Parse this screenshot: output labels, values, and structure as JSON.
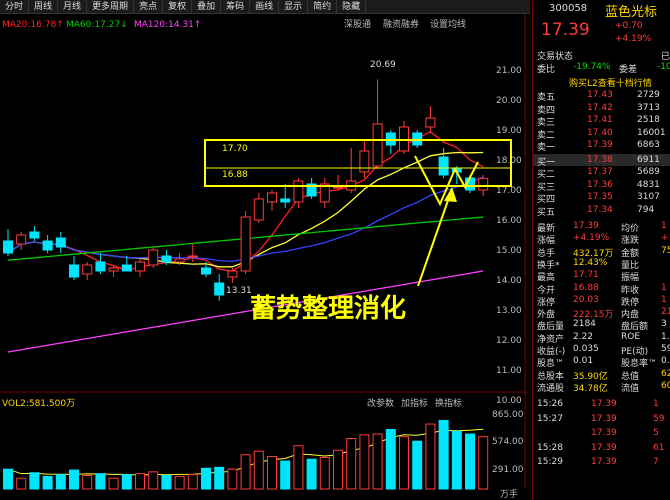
{
  "toolbar": [
    "分时",
    "周线",
    "月线",
    "更多周期",
    "亮点",
    "复权",
    "叠加",
    "筹码",
    "画线",
    "显示",
    "简约",
    "隐藏"
  ],
  "indicators": {
    "ma20": "MA20:16.78↑",
    "ma60": "MA60:17.27↓",
    "ma120": "MA120:14.31↑"
  },
  "chart_links": [
    "深股通",
    "融资融券",
    "设置均线"
  ],
  "y_ticks": [
    "21.00",
    "20.00",
    "19.00",
    "18.00",
    "17.00",
    "16.00",
    "15.00",
    "14.00",
    "13.00",
    "12.00",
    "11.00",
    "10.00"
  ],
  "annotations": {
    "high": "20.69",
    "low": "13.31",
    "box_upper": "17.70",
    "box_lower": "16.88",
    "caption": "蓄势整理消化"
  },
  "vol": {
    "label": "VOL2:581.500万",
    "ticks": [
      "865.00",
      "574.00",
      "291.00",
      "万手"
    ],
    "buttons": [
      "改参数",
      "加指标",
      "换指标"
    ]
  },
  "colors": {
    "up": "#ff3b3b",
    "down": "#00e5ff",
    "ma20": "#ff2020",
    "ma60": "#00cc00",
    "ma120": "#ff40ff",
    "short_ma": "#ffff33",
    "long_ma": "#3344ff",
    "accent": "#ffff00"
  },
  "candles": [
    {
      "o": 15.3,
      "h": 15.7,
      "l": 14.8,
      "c": 14.9
    },
    {
      "o": 15.2,
      "h": 15.6,
      "l": 15.0,
      "c": 15.5
    },
    {
      "o": 15.6,
      "h": 15.8,
      "l": 15.3,
      "c": 15.4
    },
    {
      "o": 15.3,
      "h": 15.5,
      "l": 14.9,
      "c": 15.0
    },
    {
      "o": 15.4,
      "h": 15.6,
      "l": 14.9,
      "c": 15.1
    },
    {
      "o": 14.5,
      "h": 14.8,
      "l": 14.0,
      "c": 14.1
    },
    {
      "o": 14.2,
      "h": 14.6,
      "l": 14.0,
      "c": 14.5
    },
    {
      "o": 14.6,
      "h": 14.9,
      "l": 14.2,
      "c": 14.3
    },
    {
      "o": 14.3,
      "h": 14.5,
      "l": 14.1,
      "c": 14.4
    },
    {
      "o": 14.5,
      "h": 14.8,
      "l": 14.3,
      "c": 14.3
    },
    {
      "o": 14.3,
      "h": 14.7,
      "l": 14.1,
      "c": 14.6
    },
    {
      "o": 14.5,
      "h": 15.1,
      "l": 14.4,
      "c": 15.0
    },
    {
      "o": 14.8,
      "h": 15.0,
      "l": 14.5,
      "c": 14.6
    },
    {
      "o": 14.6,
      "h": 14.9,
      "l": 14.5,
      "c": 14.7
    },
    {
      "o": 14.8,
      "h": 15.2,
      "l": 14.6,
      "c": 14.8
    },
    {
      "o": 14.4,
      "h": 14.6,
      "l": 14.1,
      "c": 14.2
    },
    {
      "o": 13.9,
      "h": 14.2,
      "l": 13.31,
      "c": 13.5
    },
    {
      "o": 14.1,
      "h": 14.4,
      "l": 13.9,
      "c": 14.3
    },
    {
      "o": 14.3,
      "h": 16.3,
      "l": 14.2,
      "c": 16.1
    },
    {
      "o": 16.0,
      "h": 16.9,
      "l": 15.9,
      "c": 16.7
    },
    {
      "o": 16.6,
      "h": 17.0,
      "l": 16.3,
      "c": 16.9
    },
    {
      "o": 16.7,
      "h": 17.2,
      "l": 16.4,
      "c": 16.6
    },
    {
      "o": 16.6,
      "h": 17.4,
      "l": 16.4,
      "c": 17.3
    },
    {
      "o": 17.2,
      "h": 17.4,
      "l": 16.7,
      "c": 16.8
    },
    {
      "o": 16.6,
      "h": 17.4,
      "l": 16.4,
      "c": 17.2
    },
    {
      "o": 17.1,
      "h": 17.5,
      "l": 17.0,
      "c": 17.1
    },
    {
      "o": 17.0,
      "h": 18.4,
      "l": 16.9,
      "c": 17.3
    },
    {
      "o": 17.6,
      "h": 18.7,
      "l": 17.4,
      "c": 18.3
    },
    {
      "o": 17.8,
      "h": 20.69,
      "l": 17.7,
      "c": 19.2
    },
    {
      "o": 18.9,
      "h": 19.0,
      "l": 18.2,
      "c": 18.5
    },
    {
      "o": 18.3,
      "h": 19.3,
      "l": 18.2,
      "c": 19.1
    },
    {
      "o": 18.9,
      "h": 19.0,
      "l": 18.4,
      "c": 18.5
    },
    {
      "o": 19.1,
      "h": 19.8,
      "l": 18.9,
      "c": 19.4
    },
    {
      "o": 18.1,
      "h": 18.4,
      "l": 17.4,
      "c": 17.5
    },
    {
      "o": 17.7,
      "h": 17.8,
      "l": 17.2,
      "c": 17.6
    },
    {
      "o": 17.4,
      "h": 17.5,
      "l": 16.9,
      "c": 17.0
    },
    {
      "o": 17.0,
      "h": 17.5,
      "l": 16.8,
      "c": 17.39
    }
  ],
  "volumes": [
    220,
    120,
    180,
    140,
    160,
    210,
    150,
    170,
    120,
    160,
    170,
    190,
    150,
    140,
    160,
    230,
    240,
    220,
    380,
    420,
    360,
    310,
    480,
    330,
    350,
    430,
    560,
    600,
    610,
    660,
    580,
    530,
    720,
    760,
    640,
    610,
    580
  ],
  "panel": {
    "code": "300058",
    "name": "蓝色光标",
    "price": "17.39",
    "change": "+0.70",
    "pct": "+4.19%",
    "status": "交易状态",
    "status_val": "已",
    "ratio_label": "委比",
    "ratio": "-19.74%",
    "diff_label": "委差",
    "diff": "-10",
    "l2": "购买L2查看十档行情",
    "asks": [
      [
        "卖五",
        "17.43",
        "2729"
      ],
      [
        "卖四",
        "17.42",
        "3713"
      ],
      [
        "卖三",
        "17.41",
        "2518"
      ],
      [
        "卖二",
        "17.40",
        "16001"
      ],
      [
        "卖一",
        "17.39",
        "6863"
      ]
    ],
    "bids": [
      [
        "买一",
        "17.38",
        "6911"
      ],
      [
        "买二",
        "17.37",
        "5689"
      ],
      [
        "买三",
        "17.36",
        "4831"
      ],
      [
        "买四",
        "17.35",
        "3107"
      ],
      [
        "买五",
        "17.34",
        "794"
      ]
    ],
    "stats": [
      [
        "最新",
        "17.39",
        "均价",
        "1"
      ],
      [
        "涨幅",
        "+4.19%",
        "涨跌",
        "+"
      ],
      [
        "总手",
        "432.17万",
        "金额",
        "75."
      ],
      [
        "换手*",
        "12.43%",
        "量比",
        ""
      ],
      [
        "最高",
        "17.71",
        "振幅",
        ""
      ],
      [
        "今开",
        "16.88",
        "昨收",
        "1"
      ],
      [
        "涨停",
        "20.03",
        "跌停",
        "1"
      ],
      [
        "外盘",
        "222.15万",
        "内盘",
        "210.0"
      ],
      [
        "盘后量",
        "2184",
        "盘后额",
        "3"
      ],
      [
        "净资产",
        "2.22",
        "ROE",
        "1."
      ],
      [
        "收益(-)",
        "0.035",
        "PE(动)",
        "59"
      ],
      [
        "股息™",
        "0.01",
        "股息率™",
        "0."
      ],
      [
        "总股本",
        "35.90亿",
        "总值",
        "624"
      ],
      [
        "流通股",
        "34.78亿",
        "流值",
        "604"
      ]
    ],
    "ticks": [
      [
        "15:26",
        "17.39",
        "1"
      ],
      [
        "15:27",
        "17.39",
        "59"
      ],
      [
        "",
        "17.39",
        "5"
      ],
      [
        "15:28",
        "17.39",
        "61"
      ],
      [
        "15:29",
        "17.39",
        "7"
      ]
    ]
  }
}
